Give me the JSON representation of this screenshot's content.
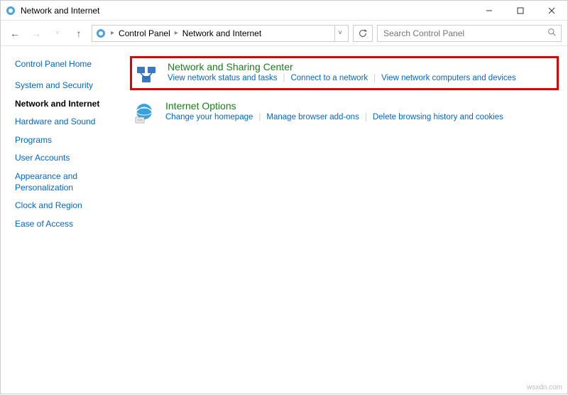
{
  "titlebar": {
    "title": "Network and Internet"
  },
  "breadcrumb": {
    "items": [
      "Control Panel",
      "Network and Internet"
    ]
  },
  "search": {
    "placeholder": "Search Control Panel"
  },
  "sidebar": {
    "home": "Control Panel Home",
    "items": [
      {
        "label": "System and Security",
        "selected": false
      },
      {
        "label": "Network and Internet",
        "selected": true
      },
      {
        "label": "Hardware and Sound",
        "selected": false
      },
      {
        "label": "Programs",
        "selected": false
      },
      {
        "label": "User Accounts",
        "selected": false
      },
      {
        "label": "Appearance and Personalization",
        "selected": false
      },
      {
        "label": "Clock and Region",
        "selected": false
      },
      {
        "label": "Ease of Access",
        "selected": false
      }
    ]
  },
  "categories": [
    {
      "title": "Network and Sharing Center",
      "highlight": true,
      "icon": "network-sharing-icon",
      "tasks": [
        "View network status and tasks",
        "Connect to a network",
        "View network computers and devices"
      ]
    },
    {
      "title": "Internet Options",
      "highlight": false,
      "icon": "internet-options-icon",
      "tasks": [
        "Change your homepage",
        "Manage browser add-ons",
        "Delete browsing history and cookies"
      ]
    }
  ],
  "watermark": "wsxdn.com"
}
